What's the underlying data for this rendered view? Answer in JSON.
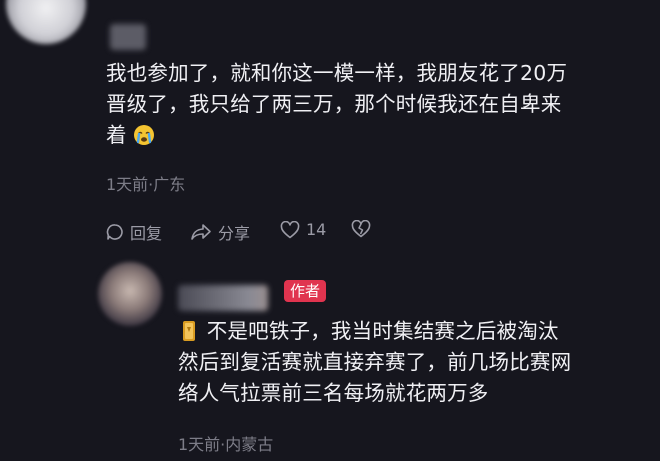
{
  "comment": {
    "lines": [
      "我也参加了，就和你这一模一样，我朋友花了20万",
      "晋级了，我只给了两三万，那个时候我还在自卑来",
      "着"
    ],
    "emoji_icon": "crying-face-emoji",
    "meta": "1天前·广东",
    "actions": {
      "reply_label": "回复",
      "share_label": "分享",
      "like_count": "14"
    }
  },
  "reply": {
    "author_badge": "作者",
    "emoji_icon": "gold-medal-emoji",
    "lines": [
      "不是吧铁子，我当时集结赛之后被淘汰",
      "然后到复活赛就直接弃赛了，前几场比赛网",
      "络人气拉票前三名每场就花两万多"
    ],
    "meta": "1天前·内蒙古"
  },
  "colors": {
    "background": "#16161e",
    "text": "#f0f0f4",
    "meta": "#7d7d88",
    "badge": "#e0344f"
  }
}
